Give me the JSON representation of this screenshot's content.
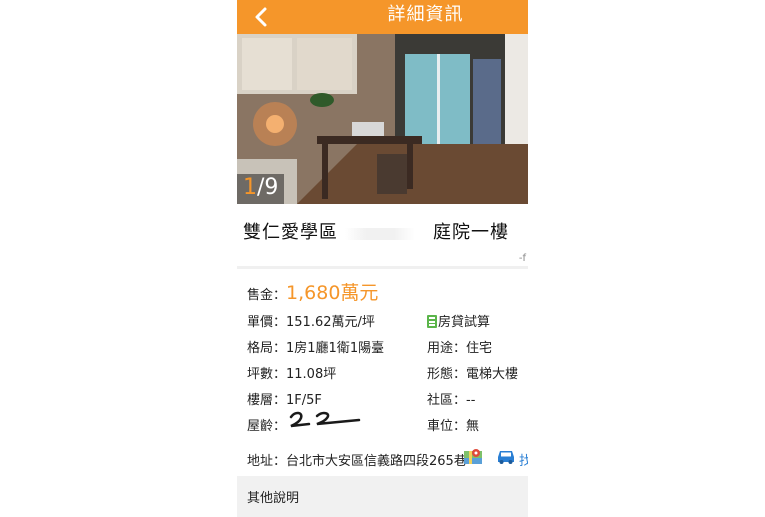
{
  "header": {
    "title": "詳細資訊",
    "background_color": "#f5962a",
    "back_icon": "chevron-left-icon"
  },
  "photo": {
    "current": "1",
    "total": "/9"
  },
  "listing": {
    "title": "雙仁愛學區　　　　　庭院一樓",
    "share_mark": "-f"
  },
  "price": {
    "label": "售金：",
    "value": "1,680萬元",
    "accent_color": "#f5962a"
  },
  "details": {
    "unit_price": "單價：151.62萬元/坪",
    "calc_label": "房貸試算",
    "calc_icon": "calculator-icon",
    "layout": "格局：1房1廳1衛1陽臺",
    "usage": "用途：住宅",
    "area": "坪數：11.08坪",
    "type": "形態：電梯大樓",
    "floor": "樓層：1F/5F",
    "community": "社區：--",
    "age": "屋齡：",
    "parking": "車位：無"
  },
  "address": {
    "text": "地址：台北市大安區信義路四段265巷",
    "map_icon": "map-icon",
    "car_icon": "car-icon",
    "car_text": "找"
  },
  "other": {
    "label": "其他說明"
  }
}
